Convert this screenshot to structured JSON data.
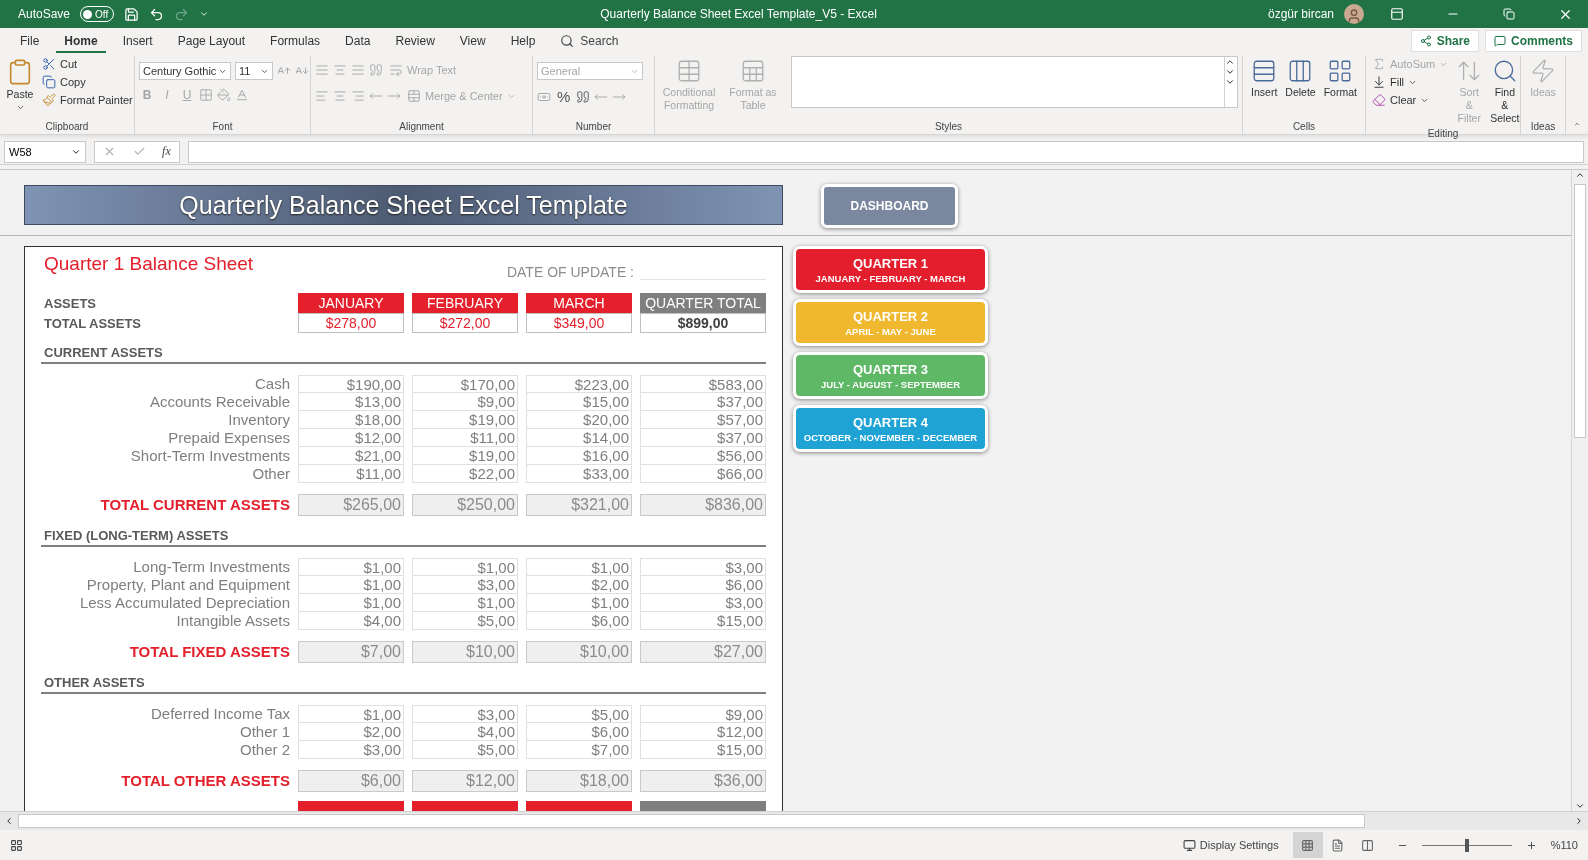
{
  "title_bar": {
    "autosave": {
      "label": "AutoSave",
      "state": "Off",
      "on": false
    },
    "title": "Quarterly Balance Sheet Excel Template_V5  -  Excel",
    "user": "özgür bircan"
  },
  "menu": {
    "tabs": [
      {
        "label": "File",
        "selected": false
      },
      {
        "label": "Home",
        "selected": true
      },
      {
        "label": "Insert",
        "selected": false
      },
      {
        "label": "Page Layout",
        "selected": false
      },
      {
        "label": "Formulas",
        "selected": false
      },
      {
        "label": "Data",
        "selected": false
      },
      {
        "label": "Review",
        "selected": false
      },
      {
        "label": "View",
        "selected": false
      },
      {
        "label": "Help",
        "selected": false
      }
    ],
    "search": "Search",
    "share": "Share",
    "comments": "Comments"
  },
  "ribbon": [
    {
      "kind": "clipboard",
      "label": "Clipboard",
      "large": {
        "label": "Paste"
      },
      "small": [
        {
          "label": "Cut"
        },
        {
          "label": "Copy"
        },
        {
          "label": "Format Painter"
        }
      ]
    },
    {
      "kind": "font",
      "label": "Font",
      "font": "Century Gothic",
      "size": "11",
      "styles": [
        {
          "label": "B",
          "disabled": true
        },
        {
          "label": "I",
          "disabled": true
        },
        {
          "label": "U",
          "disabled": true
        }
      ]
    },
    {
      "kind": "alignment",
      "label": "Alignment",
      "wrap": {
        "label": "Wrap Text",
        "disabled": true
      },
      "merge": {
        "label": "Merge & Center",
        "disabled": true
      }
    },
    {
      "kind": "number",
      "label": "Number",
      "format": {
        "value": "General",
        "disabled": true
      },
      "percent": "%"
    },
    {
      "kind": "styles",
      "label": "Styles",
      "buttons": [
        {
          "label": "Conditional Formatting",
          "disabled": true
        },
        {
          "label": "Format as Table",
          "disabled": true
        }
      ]
    },
    {
      "kind": "cells",
      "label": "Cells",
      "buttons": [
        {
          "label": "Insert",
          "disabled": false
        },
        {
          "label": "Delete",
          "disabled": false
        },
        {
          "label": "Format",
          "disabled": false
        }
      ]
    },
    {
      "kind": "editing",
      "label": "Editing",
      "small": [
        {
          "label": "AutoSum",
          "disabled": true
        },
        {
          "label": "Fill",
          "disabled": false
        },
        {
          "label": "Clear",
          "disabled": false
        }
      ],
      "buttons": [
        {
          "label": "Sort & Filter",
          "disabled": true
        },
        {
          "label": "Find & Select",
          "disabled": false
        }
      ]
    },
    {
      "kind": "ideas",
      "label": "Ideas",
      "buttons": [
        {
          "label": "Ideas",
          "disabled": true
        }
      ]
    }
  ],
  "formula_bar": {
    "name_box": "W58",
    "fx": "fx"
  },
  "sheet": {
    "banner": "Quarterly Balance Sheet Excel Template",
    "dashboard": "DASHBOARD",
    "quarters": [
      {
        "title": "QUARTER 1",
        "months": "JANUARY - FEBRUARY - MARCH",
        "color": "#e31e2d"
      },
      {
        "title": "QUARTER 2",
        "months": "APRIL - MAY - JUNE",
        "color": "#f0b82e"
      },
      {
        "title": "QUARTER 3",
        "months": "JULY - AUGUST - SEPTEMBER",
        "color": "#5eb866"
      },
      {
        "title": "QUARTER 4",
        "months": "OCTOBER - NOVEMBER - DECEMBER",
        "color": "#1fa3d5"
      }
    ],
    "panel": {
      "title": "Quarter 1 Balance Sheet",
      "date_label": "DATE OF UPDATE :",
      "assets_label": "ASSETS",
      "columns": [
        {
          "label": "JANUARY",
          "kind": "month",
          "color": "#e3202b"
        },
        {
          "label": "FEBRUARY",
          "kind": "month",
          "color": "#e3202b"
        },
        {
          "label": "MARCH",
          "kind": "month",
          "color": "#e3202b"
        },
        {
          "label": "QUARTER TOTAL",
          "kind": "total",
          "color": "#7f7f7f"
        }
      ],
      "total_assets": {
        "label": "TOTAL ASSETS",
        "values": [
          "$278,00",
          "$272,00",
          "$349,00",
          "$899,00"
        ]
      },
      "sections": [
        {
          "heading": "CURRENT ASSETS",
          "rows": [
            {
              "label": "Cash",
              "values": [
                "$190,00",
                "$170,00",
                "$223,00",
                "$583,00"
              ]
            },
            {
              "label": "Accounts Receivable",
              "values": [
                "$13,00",
                "$9,00",
                "$15,00",
                "$37,00"
              ]
            },
            {
              "label": "Inventory",
              "values": [
                "$18,00",
                "$19,00",
                "$20,00",
                "$57,00"
              ]
            },
            {
              "label": "Prepaid Expenses",
              "values": [
                "$12,00",
                "$11,00",
                "$14,00",
                "$37,00"
              ]
            },
            {
              "label": "Short-Term Investments",
              "values": [
                "$21,00",
                "$19,00",
                "$16,00",
                "$56,00"
              ]
            },
            {
              "label": "Other",
              "values": [
                "$11,00",
                "$22,00",
                "$33,00",
                "$66,00"
              ]
            }
          ],
          "total": {
            "label": "TOTAL CURRENT ASSETS",
            "values": [
              "$265,00",
              "$250,00",
              "$321,00",
              "$836,00"
            ]
          }
        },
        {
          "heading": "FIXED (LONG-TERM) ASSETS",
          "rows": [
            {
              "label": "Long-Term Investments",
              "values": [
                "$1,00",
                "$1,00",
                "$1,00",
                "$3,00"
              ]
            },
            {
              "label": "Property, Plant and Equipment",
              "values": [
                "$1,00",
                "$3,00",
                "$2,00",
                "$6,00"
              ]
            },
            {
              "label": "Less Accumulated Depreciation",
              "values": [
                "$1,00",
                "$1,00",
                "$1,00",
                "$3,00"
              ]
            },
            {
              "label": "Intangible Assets",
              "values": [
                "$4,00",
                "$5,00",
                "$6,00",
                "$15,00"
              ]
            }
          ],
          "total": {
            "label": "TOTAL FIXED ASSETS",
            "values": [
              "$7,00",
              "$10,00",
              "$10,00",
              "$27,00"
            ]
          }
        },
        {
          "heading": "OTHER ASSETS",
          "rows": [
            {
              "label": "Deferred Income Tax",
              "values": [
                "$1,00",
                "$3,00",
                "$5,00",
                "$9,00"
              ]
            },
            {
              "label": "Other 1",
              "values": [
                "$2,00",
                "$4,00",
                "$6,00",
                "$12,00"
              ]
            },
            {
              "label": "Other 2",
              "values": [
                "$3,00",
                "$5,00",
                "$7,00",
                "$15,00"
              ]
            }
          ],
          "total": {
            "label": "TOTAL OTHER ASSETS",
            "values": [
              "$6,00",
              "$12,00",
              "$18,00",
              "$36,00"
            ]
          }
        }
      ]
    }
  },
  "status_bar": {
    "display_settings": "Display Settings",
    "views": [
      {
        "selected": true
      },
      {
        "selected": false
      },
      {
        "selected": false
      }
    ],
    "zoom": {
      "level": 0.5,
      "reading": "%110"
    }
  }
}
